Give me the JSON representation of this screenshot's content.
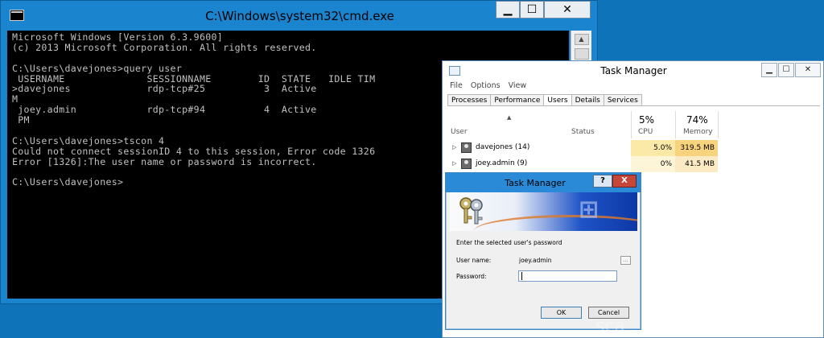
{
  "cmd": {
    "title": "C:\\Windows\\system32\\cmd.exe",
    "lines": [
      "Microsoft Windows [Version 6.3.9600]",
      "(c) 2013 Microsoft Corporation. All rights reserved.",
      "",
      "C:\\Users\\davejones>query user",
      " USERNAME              SESSIONNAME        ID  STATE   IDLE TIM",
      ">davejones             rdp-tcp#25          3  Active",
      "M",
      " joey.admin            rdp-tcp#94          4  Active",
      " PM",
      "",
      "C:\\Users\\davejones>tscon 4",
      "Could not connect sessionID 4 to this session, Error code 1326",
      "Error [1326]:The user name or password is incorrect.",
      "",
      "C:\\Users\\davejones>"
    ]
  },
  "taskmanager": {
    "title": "Task Manager",
    "menu": [
      "File",
      "Options",
      "View"
    ],
    "tabs": [
      "Processes",
      "Performance",
      "Users",
      "Details",
      "Services"
    ],
    "active_tab": "Users",
    "columns": {
      "user": "User",
      "status": "Status",
      "cpu_pct": "5%",
      "cpu": "CPU",
      "mem_pct": "74%",
      "mem": "Memory"
    },
    "rows": [
      {
        "name": "davejones (14)",
        "cpu": "5.0%",
        "mem": "319.5 MB"
      },
      {
        "name": "joey.admin (9)",
        "cpu": "0%",
        "mem": "41.5 MB"
      }
    ],
    "colors": {
      "cpu_high": "#fbe9a8",
      "mem_high": "#f8d37d",
      "cpu_low": "#fdf5d8",
      "mem_low": "#fbeac4"
    }
  },
  "dialog": {
    "title": "Task Manager",
    "help": "?",
    "close": "X",
    "prompt": "Enter the selected user's password",
    "username_label": "User name:",
    "username_value": "joey.admin",
    "password_label": "Password:",
    "browse": "...",
    "ok": "OK",
    "cancel": "Cancel"
  },
  "watermark": "sca"
}
